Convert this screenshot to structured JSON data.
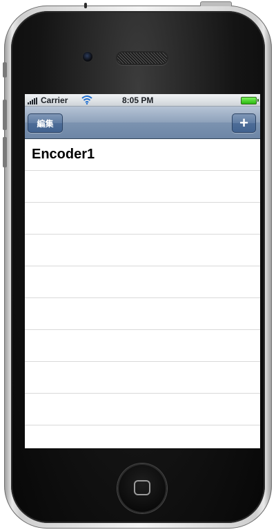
{
  "status": {
    "carrier": "Carrier",
    "time": "8:05 PM"
  },
  "nav": {
    "edit_label": "編集",
    "add_label": "+"
  },
  "list": {
    "items": [
      {
        "label": "Encoder1"
      },
      {
        "label": ""
      },
      {
        "label": ""
      },
      {
        "label": ""
      },
      {
        "label": ""
      },
      {
        "label": ""
      },
      {
        "label": ""
      },
      {
        "label": ""
      },
      {
        "label": ""
      },
      {
        "label": ""
      }
    ]
  },
  "colors": {
    "navbar": "#7c93b0",
    "battery": "#2ab90f",
    "separator": "#d9d9d9"
  },
  "icons": {
    "signal": "signal-bars-icon",
    "wifi": "wifi-icon",
    "battery": "battery-icon",
    "camera": "camera-icon",
    "speaker": "speaker-grille-icon",
    "home": "home-button-icon"
  }
}
